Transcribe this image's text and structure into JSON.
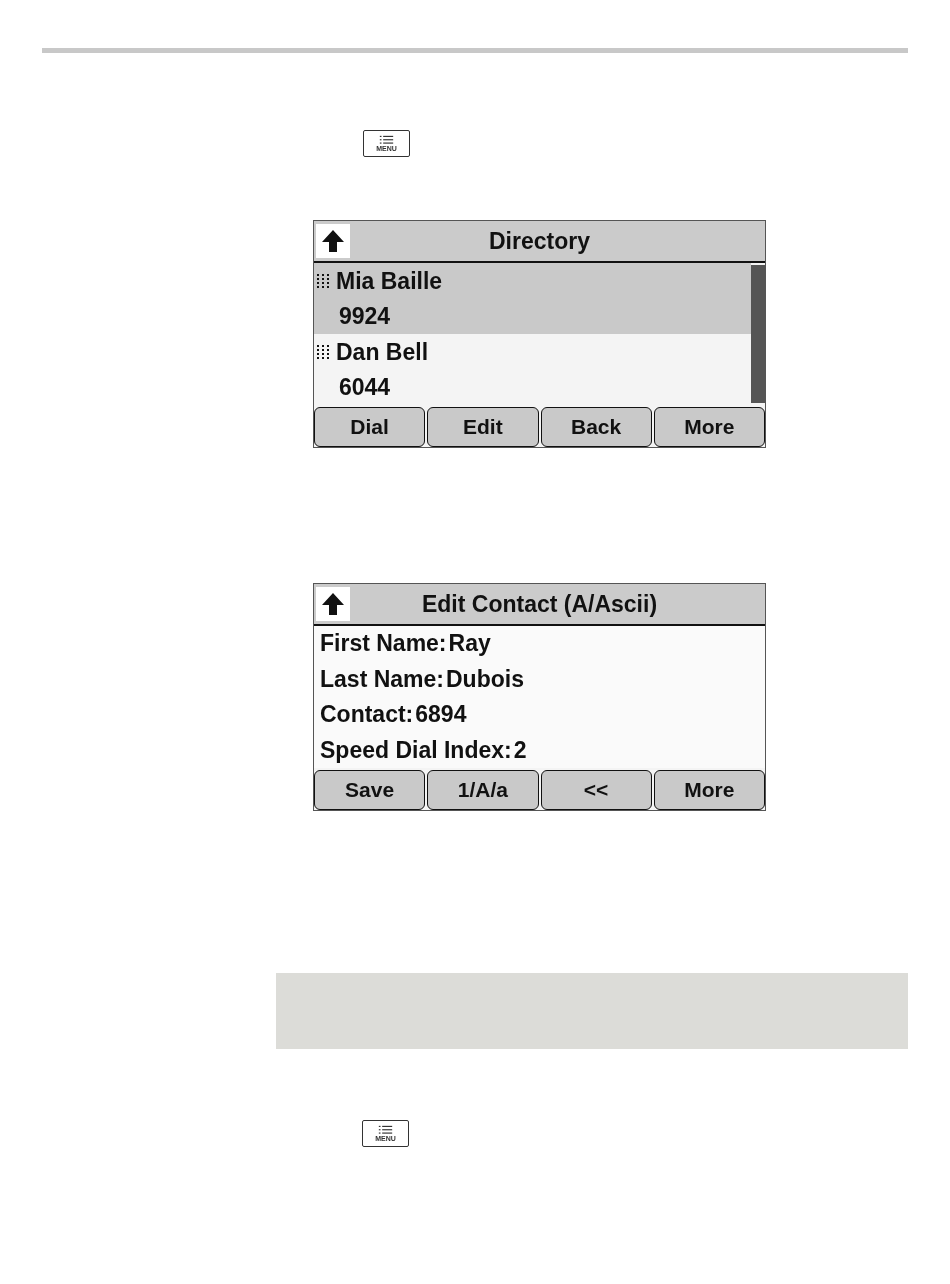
{
  "menu_keys": [
    {
      "label": "MENU"
    },
    {
      "label": "MENU"
    }
  ],
  "directory_screen": {
    "title": "Directory",
    "entries": [
      {
        "name": "Mia Baille",
        "number": "9924",
        "selected": true
      },
      {
        "name": "Dan Bell",
        "number": "6044",
        "selected": false
      }
    ],
    "softkeys": [
      "Dial",
      "Edit",
      "Back",
      "More"
    ]
  },
  "edit_screen": {
    "title": "Edit Contact (A/Ascii)",
    "fields": [
      {
        "label": "First Name:",
        "value": "Ray"
      },
      {
        "label": "Last Name:",
        "value": "Dubois"
      },
      {
        "label": "Contact:",
        "value": "6894"
      },
      {
        "label": "Speed Dial Index:",
        "value": "2"
      }
    ],
    "softkeys": [
      "Save",
      "1/A/a",
      "<<",
      "More"
    ]
  },
  "note_box": {
    "kind": "note"
  }
}
